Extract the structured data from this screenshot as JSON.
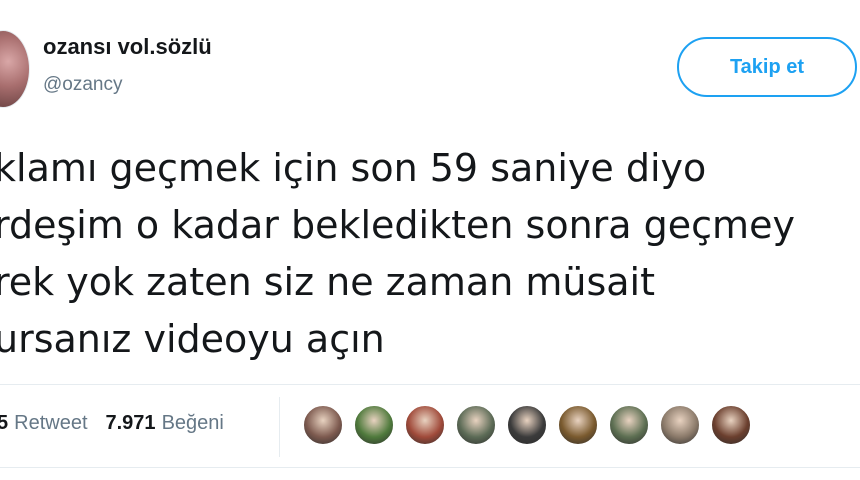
{
  "author": {
    "display_name": "ozansı vol.sözlü",
    "handle": "@ozancy"
  },
  "follow_button_label": "Takip et",
  "tweet": {
    "lines": [
      "klamı geçmek için son 59 saniye diyo",
      "rdeşim o kadar bekledikten sonra geçmey",
      "rek yok zaten siz ne zaman müsait",
      "ursanız videoyu açın"
    ]
  },
  "stats": {
    "retweet_count": "5",
    "retweet_label": "Retweet",
    "like_count": "7.971",
    "like_label": "Beğeni"
  },
  "likers": [
    {
      "name": "liker-1",
      "color": "#7d5a4f"
    },
    {
      "name": "liker-2",
      "color": "#4f7a3c"
    },
    {
      "name": "liker-3",
      "color": "#a04a3a"
    },
    {
      "name": "liker-4",
      "color": "#5c6b56"
    },
    {
      "name": "liker-5",
      "color": "#3b3b3b"
    },
    {
      "name": "liker-6",
      "color": "#7a5a2e"
    },
    {
      "name": "liker-7",
      "color": "#5d6f52"
    },
    {
      "name": "liker-8",
      "color": "#8b7a6a"
    },
    {
      "name": "liker-9",
      "color": "#6b3f2e"
    }
  ],
  "colors": {
    "accent": "#1da1f2",
    "text": "#14171a",
    "muted": "#657786",
    "divider": "#e6ecf0"
  }
}
